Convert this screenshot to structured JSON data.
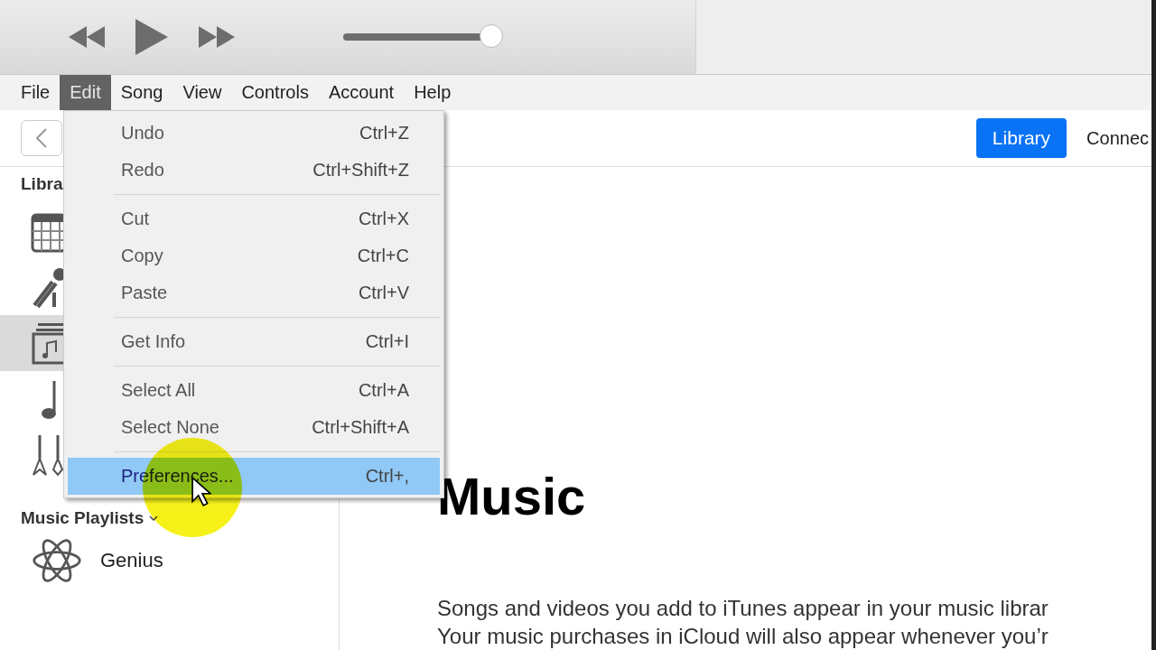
{
  "player": {
    "controls": [
      {
        "kind": "rewind"
      },
      {
        "kind": "play"
      },
      {
        "kind": "forward"
      }
    ],
    "volume": {
      "level": 0.93
    }
  },
  "menu_bar": [
    {
      "label": "File",
      "selected": false
    },
    {
      "label": "Edit",
      "selected": true
    },
    {
      "label": "Song",
      "selected": false
    },
    {
      "label": "View",
      "selected": false
    },
    {
      "label": "Controls",
      "selected": false
    },
    {
      "label": "Account",
      "selected": false
    },
    {
      "label": "Help",
      "selected": false
    }
  ],
  "nav": {
    "tabs": [
      {
        "label": "Library",
        "selected": true
      },
      {
        "label": "Connec",
        "selected": false
      }
    ]
  },
  "sidebar": {
    "heading": "Libra",
    "items": [
      {
        "kind": "grid",
        "selected": false
      },
      {
        "kind": "mic",
        "selected": false
      },
      {
        "kind": "album",
        "selected": true
      },
      {
        "kind": "note",
        "selected": false
      },
      {
        "kind": "guitars",
        "selected": false
      }
    ],
    "playlists_heading": "Music Playlists",
    "playlists": [
      {
        "label": "Genius"
      }
    ]
  },
  "edit_menu": {
    "groups": [
      [
        {
          "label": "Undo",
          "shortcut": "Ctrl+Z",
          "selected": false
        },
        {
          "label": "Redo",
          "shortcut": "Ctrl+Shift+Z",
          "selected": false
        }
      ],
      [
        {
          "label": "Cut",
          "shortcut": "Ctrl+X",
          "selected": false
        },
        {
          "label": "Copy",
          "shortcut": "Ctrl+C",
          "selected": false
        },
        {
          "label": "Paste",
          "shortcut": "Ctrl+V",
          "selected": false
        }
      ],
      [
        {
          "label": "Get Info",
          "shortcut": "Ctrl+I",
          "selected": false
        }
      ],
      [
        {
          "label": "Select All",
          "shortcut": "Ctrl+A",
          "selected": false
        },
        {
          "label": "Select None",
          "shortcut": "Ctrl+Shift+A",
          "selected": false
        }
      ],
      [
        {
          "label": "Preferences...",
          "shortcut": "Ctrl+,",
          "selected": true
        }
      ]
    ]
  },
  "main": {
    "title": "Music",
    "lines": [
      "Songs and videos you add to iTunes appear in your music librar",
      "Your music purchases in iCloud will also appear whenever you’r"
    ]
  }
}
